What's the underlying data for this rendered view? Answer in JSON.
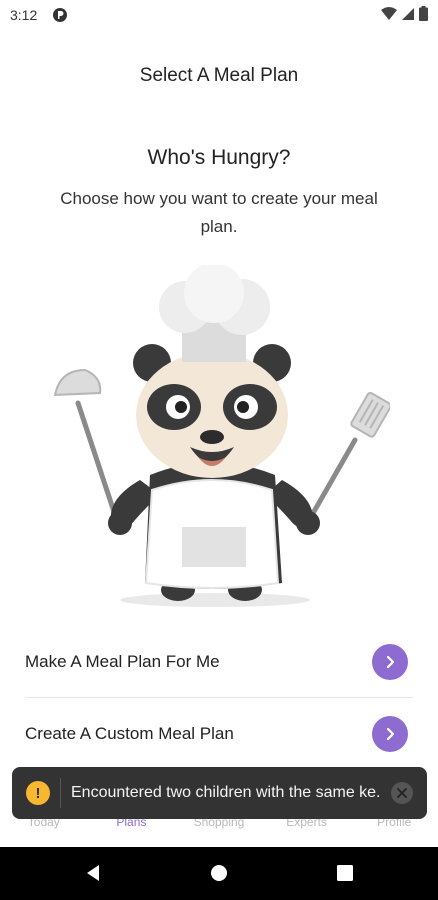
{
  "status_bar": {
    "time": "3:12",
    "icons": [
      "app-notification-icon",
      "wifi-icon",
      "signal-icon",
      "battery-icon"
    ]
  },
  "header": {
    "title": "Select A Meal Plan"
  },
  "hero": {
    "heading": "Who's Hungry?",
    "subtext": "Choose how you want to create your meal plan."
  },
  "options": [
    {
      "label": "Make A Meal Plan For Me",
      "icon": "chevron-right-icon"
    },
    {
      "label": "Create A Custom Meal Plan",
      "icon": "chevron-right-icon"
    }
  ],
  "bottom_nav": {
    "items": [
      {
        "label": "Today"
      },
      {
        "label": "Plans"
      },
      {
        "label": "Shopping"
      },
      {
        "label": "Experts"
      },
      {
        "label": "Profile"
      }
    ],
    "active_index": 1
  },
  "toast": {
    "message": "Encountered two children with the same ke...",
    "icon": "warning-icon",
    "close_icon": "close-icon"
  },
  "system_nav": {
    "buttons": [
      "back-icon",
      "home-icon",
      "recents-icon"
    ]
  },
  "colors": {
    "accent": "#8e6bd0",
    "toast_bg": "#333333",
    "warning": "#f7b731"
  }
}
